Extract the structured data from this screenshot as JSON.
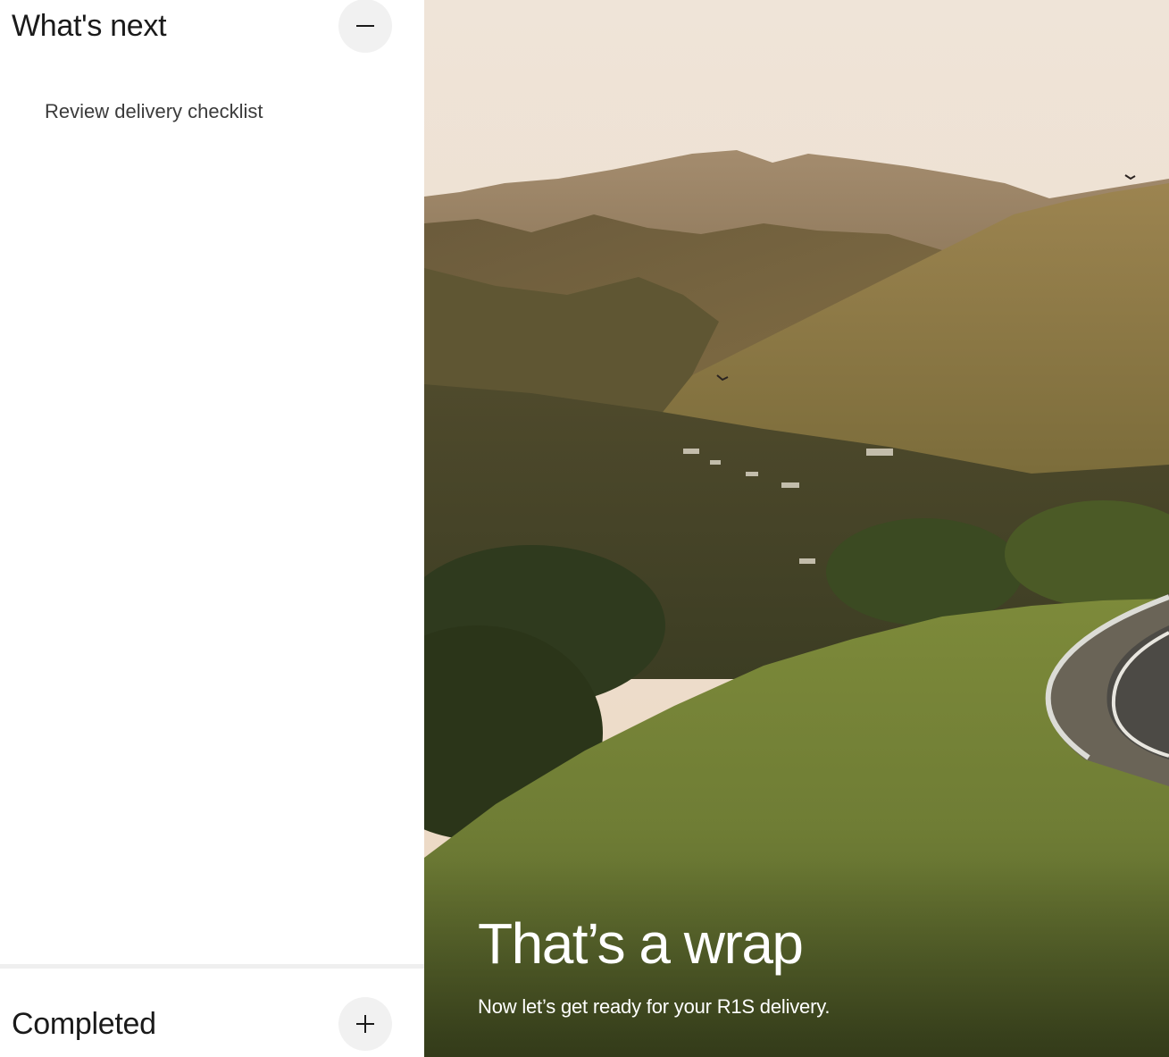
{
  "next_section": {
    "title": "What's next",
    "toggle_icon": "minus-icon",
    "items": [
      {
        "label": "Review delivery checklist"
      }
    ]
  },
  "completed_section": {
    "title": "Completed",
    "toggle_icon": "plus-icon"
  },
  "hero": {
    "title": "That’s a wrap",
    "subtitle": "Now let’s get ready for your R1S delivery."
  }
}
